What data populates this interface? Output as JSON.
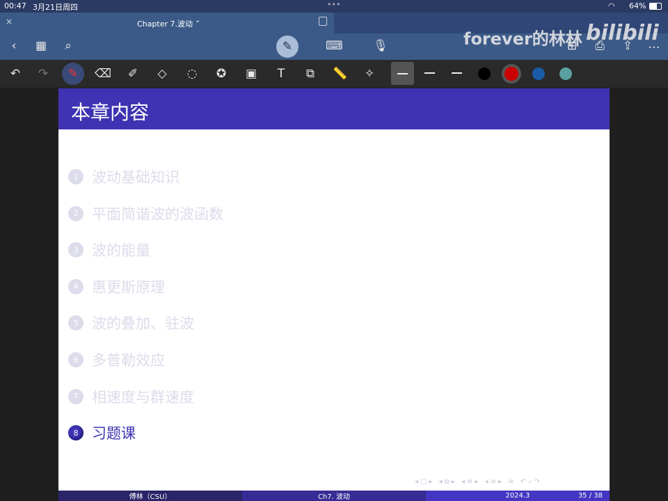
{
  "status": {
    "time": "00:47",
    "date": "3月21日周四",
    "battery": "64%"
  },
  "titlebar": {
    "title": "Chapter 7.波动",
    "close": "×"
  },
  "watermark": "forever的林林",
  "watermark_logo": "bilibili",
  "colors": {
    "header": "#3f33b3",
    "toolbar": "#3c5a87",
    "pen_red": "#cc0000",
    "blue": "#1b5aa5",
    "teal": "#5ba0a0"
  },
  "slide": {
    "title": "本章内容",
    "items": [
      {
        "n": "1",
        "label": "波动基础知识",
        "active": false
      },
      {
        "n": "2",
        "label": "平面简谐波的波函数",
        "active": false
      },
      {
        "n": "3",
        "label": "波的能量",
        "active": false
      },
      {
        "n": "4",
        "label": "惠更斯原理",
        "active": false
      },
      {
        "n": "5",
        "label": "波的叠加、驻波",
        "active": false
      },
      {
        "n": "6",
        "label": "多普勒效应",
        "active": false
      },
      {
        "n": "7",
        "label": "相速度与群速度",
        "active": false
      },
      {
        "n": "8",
        "label": "习题课",
        "active": true
      }
    ],
    "footer": {
      "author": "傅林（CSU）",
      "chapter": "Ch7. 波动",
      "date": "2024.3",
      "page": "35 / 38"
    }
  }
}
